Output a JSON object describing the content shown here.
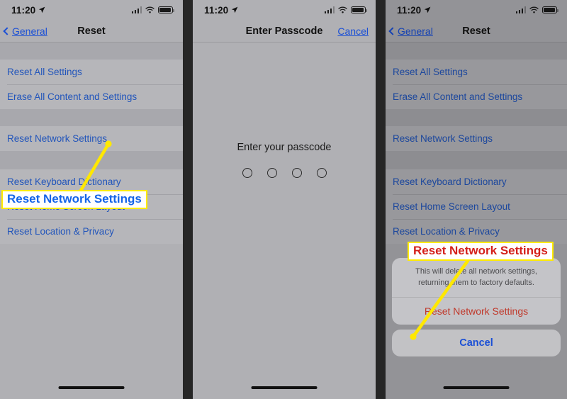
{
  "statusbar": {
    "time": "11:20",
    "location_icon": "location-arrow-icon",
    "signal_icon": "cellular-bars-icon",
    "wifi_icon": "wifi-icon",
    "battery_icon": "battery-icon"
  },
  "panel1": {
    "nav": {
      "back_label": "General",
      "title": "Reset"
    },
    "rows": [
      "Reset All Settings",
      "Erase All Content and Settings",
      "Reset Network Settings",
      "Reset Keyboard Dictionary",
      "Reset Home Screen Layout",
      "Reset Location & Privacy"
    ],
    "callout": "Reset Network Settings"
  },
  "panel2": {
    "nav": {
      "title": "Enter Passcode",
      "cancel_label": "Cancel"
    },
    "prompt": "Enter your passcode",
    "dot_count": 4
  },
  "panel3": {
    "nav": {
      "back_label": "General",
      "title": "Reset"
    },
    "rows": [
      "Reset All Settings",
      "Erase All Content and Settings",
      "Reset Network Settings",
      "Reset Keyboard Dictionary",
      "Reset Home Screen Layout",
      "Reset Location & Privacy"
    ],
    "callout": "Reset Network Settings",
    "sheet": {
      "message": "This will delete all network settings, returning them to factory defaults.",
      "destructive_label": "Reset Network Settings",
      "cancel_label": "Cancel"
    }
  },
  "annotation": {
    "line_color": "#ffe800",
    "dot_color": "#ffe800",
    "callout_border": "#ffeb00",
    "callout1_text_color": "#1565e8",
    "callout3_text_color": "#d4201a"
  }
}
